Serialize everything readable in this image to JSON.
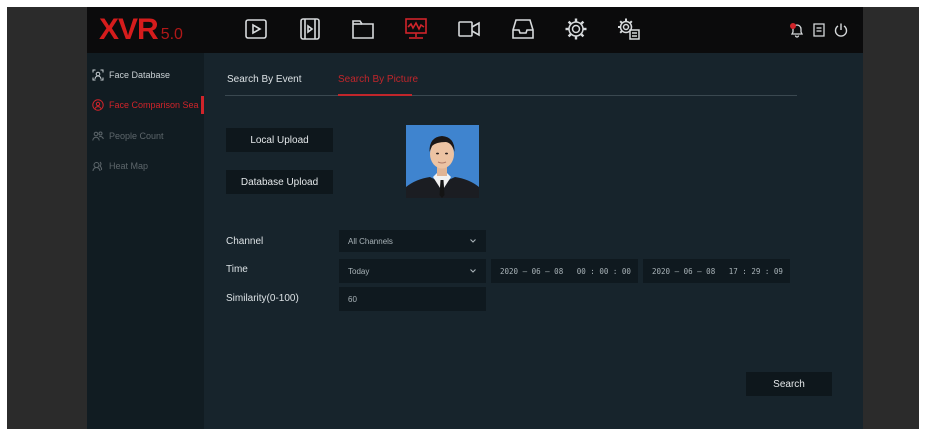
{
  "app": {
    "logo_main": "XVR",
    "logo_version": "5.0"
  },
  "topbar": {
    "nav_icons": [
      "playback-icon",
      "film-icon",
      "folder-icon",
      "ai-monitor-icon",
      "camera-icon",
      "inbox-icon",
      "gear-icon",
      "settings-list-icon"
    ],
    "active_index": 3,
    "system_icons": [
      "alarm-bell-icon",
      "backup-icon",
      "power-icon"
    ]
  },
  "sidebar": {
    "items": [
      {
        "label": "Face Database",
        "icon": "face-database-icon",
        "state": "normal"
      },
      {
        "label": "Face Comparison Sea",
        "icon": "face-search-icon",
        "state": "active"
      },
      {
        "label": "People Count",
        "icon": "people-count-icon",
        "state": "disabled"
      },
      {
        "label": "Heat Map",
        "icon": "heat-map-icon",
        "state": "disabled"
      }
    ]
  },
  "tabs": [
    {
      "label": "Search By Event",
      "active": false
    },
    {
      "label": "Search By Picture",
      "active": true
    }
  ],
  "upload": {
    "local_label": "Local Upload",
    "database_label": "Database Upload"
  },
  "form": {
    "channel_label": "Channel",
    "channel_value": "All Channels",
    "time_label": "Time",
    "time_value": "Today",
    "start_datetime": "2020 — 06 — 08   00 : 00 : 00",
    "end_datetime": "2020 — 06 — 08   17 : 29 : 09",
    "similarity_label": "Similarity(0-100)",
    "similarity_value": "60"
  },
  "actions": {
    "search_label": "Search"
  },
  "colors": {
    "accent": "#d0242a",
    "background": "#17242c",
    "topbar": "#0b0b0c",
    "sidebar": "#111c22",
    "field": "#0f191f"
  }
}
